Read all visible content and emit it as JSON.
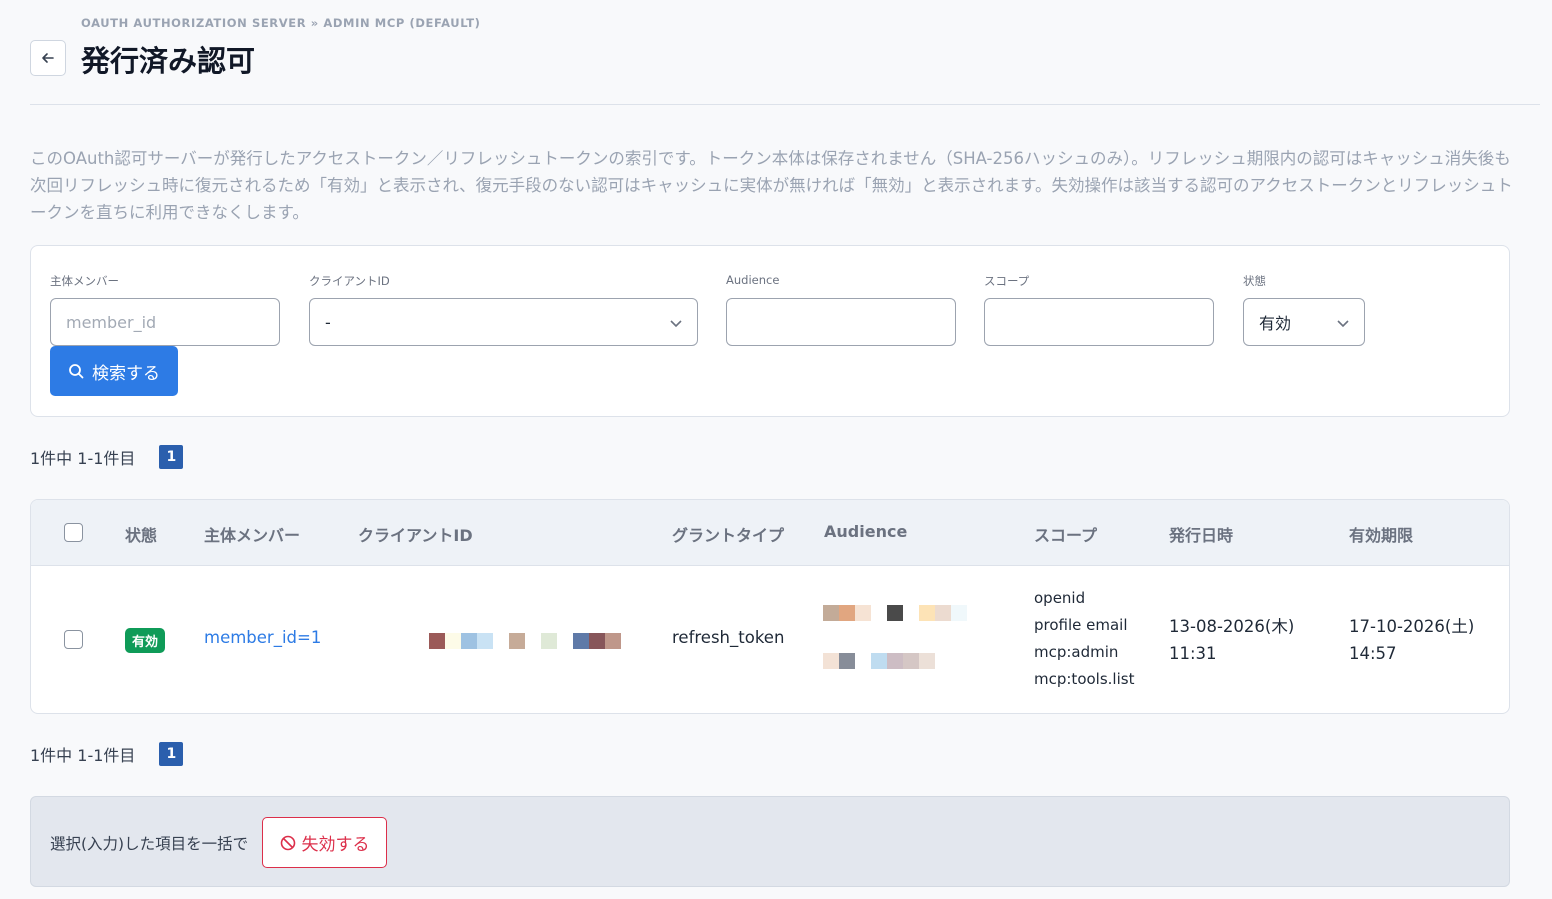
{
  "header": {
    "breadcrumb": "OAUTH AUTHORIZATION SERVER » ADMIN MCP (DEFAULT)",
    "title": "発行済み認可",
    "back_icon": "arrow-left-icon"
  },
  "description": "このOAuth認可サーバーが発行したアクセストークン／リフレッシュトークンの索引です。トークン本体は保存されません（SHA-256ハッシュのみ）。リフレッシュ期限内の認可はキャッシュ消失後も次回リフレッシュ時に復元されるため「有効」と表示され、復元手段のない認可はキャッシュに実体が無ければ「無効」と表示されます。失効操作は該当する認可のアクセストークンとリフレッシュトークンを直ちに利用できなくします。",
  "filters": {
    "member_label": "主体メンバー",
    "member_placeholder": "member_id",
    "client_label": "クライアントID",
    "client_value": "-",
    "audience_label": "Audience",
    "audience_value": "",
    "scope_label": "スコープ",
    "scope_value": "",
    "status_label": "状態",
    "status_value": "有効",
    "search_button": "検索する"
  },
  "pagination": {
    "summary": "1件中 1-1件目",
    "current_page": "1"
  },
  "table": {
    "columns": [
      "状態",
      "主体メンバー",
      "クライアントID",
      "グラントタイプ",
      "Audience",
      "スコープ",
      "発行日時",
      "有効期限"
    ],
    "rows": [
      {
        "status": "有効",
        "member": "member_id=1",
        "grant_type": "refresh_token",
        "scopes": [
          "openid",
          "profile email",
          "mcp:admin",
          "mcp:tools.list"
        ],
        "issued_date": "13-08-2026(木)",
        "issued_time": "11:31",
        "expires_date": "17-10-2026(土)",
        "expires_time": "14:57"
      }
    ]
  },
  "bulk": {
    "label": "選択(入力)した項目を一括で",
    "revoke_button": "失効する"
  },
  "colors": {
    "primary": "#2d7be5",
    "success": "#0f9b58",
    "danger": "#dc2f4a",
    "page_badge": "#2b5fad"
  }
}
